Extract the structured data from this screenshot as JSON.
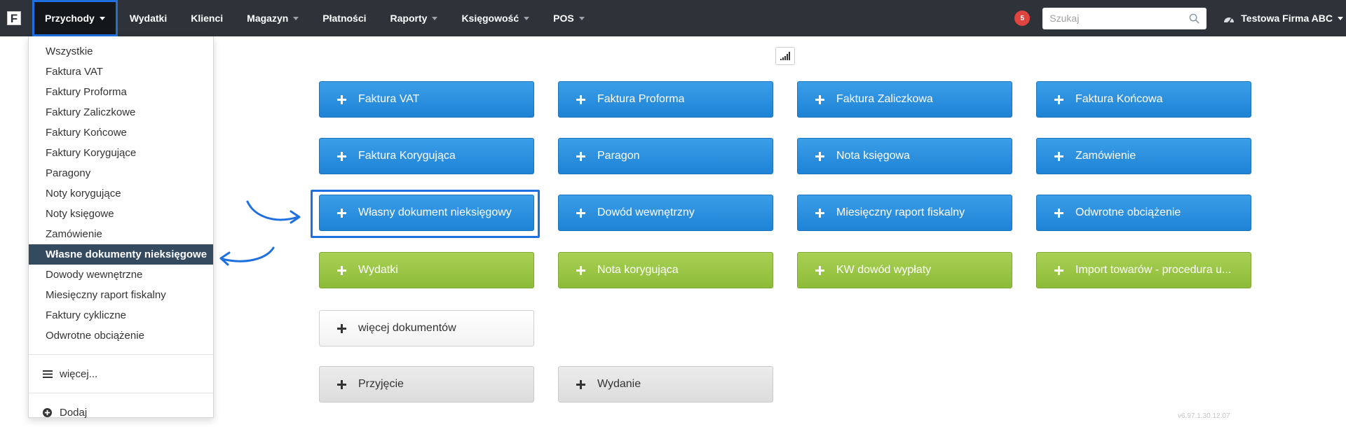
{
  "brand": {
    "letter": "F"
  },
  "nav": {
    "items": [
      {
        "label": "Przychody",
        "active": true,
        "caret": true
      },
      {
        "label": "Wydatki",
        "caret": false
      },
      {
        "label": "Klienci",
        "caret": false
      },
      {
        "label": "Magazyn",
        "caret": true
      },
      {
        "label": "Płatności",
        "caret": false
      },
      {
        "label": "Raporty",
        "caret": true
      },
      {
        "label": "Księgowość",
        "caret": true
      },
      {
        "label": "POS",
        "caret": true
      }
    ],
    "badge_count": "5",
    "search_placeholder": "Szukaj",
    "company": "Testowa Firma ABC"
  },
  "dropdown": {
    "items": [
      "Wszystkie",
      "Faktura VAT",
      "Faktury Proforma",
      "Faktury Zaliczkowe",
      "Faktury Końcowe",
      "Faktury Korygujące",
      "Paragony",
      "Noty korygujące",
      "Noty księgowe",
      "Zamówienie",
      "Własne dokumenty nieksięgowe",
      "Dowody wewnętrzne",
      "Miesięczny raport fiskalny",
      "Faktury cykliczne",
      "Odwrotne obciążenie"
    ],
    "selected_index": 10,
    "more_label": "więcej...",
    "add_label": "Dodaj"
  },
  "buttons": {
    "row1": [
      "Faktura VAT",
      "Faktura Proforma",
      "Faktura Zaliczkowa",
      "Faktura Końcowa"
    ],
    "row2": [
      "Faktura Korygująca",
      "Paragon",
      "Nota księgowa",
      "Zamówienie"
    ],
    "row3": [
      "Własny dokument nieksięgowy",
      "Dowód wewnętrzny",
      "Miesięczny raport fiskalny",
      "Odwrotne obciążenie"
    ],
    "row4": [
      "Wydatki",
      "Nota korygująca",
      "KW dowód wypłaty",
      "Import towarów - procedura u..."
    ],
    "more": "więcej dokumentów",
    "row6": [
      "Przyjęcie",
      "Wydanie"
    ]
  },
  "colors": {
    "navbar": "#2d3339",
    "accent": "#1e6fe0",
    "blue_button": "#2a8fe0",
    "green_button": "#9bc647",
    "selected_item": "#344a5e",
    "badge": "#e0443f"
  },
  "version": "v6.97.1.30.12.07"
}
